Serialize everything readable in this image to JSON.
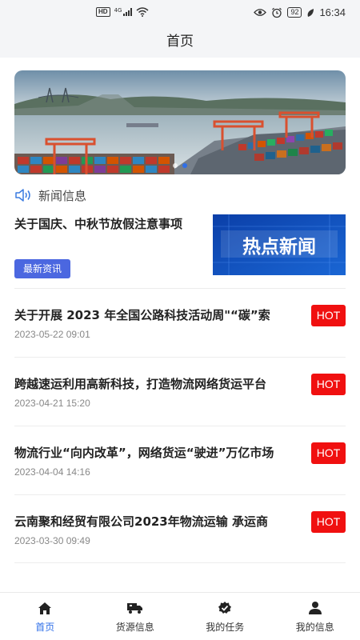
{
  "status_bar": {
    "network_badge": "HD",
    "network_type": "4G",
    "battery": "92",
    "time": "16:34"
  },
  "header": {
    "title": "首页"
  },
  "banner": {
    "slides": 2,
    "active_index": 1
  },
  "news_section": {
    "title": "新闻信息",
    "featured": {
      "title": "关于国庆、中秋节放假注意事项",
      "tag": "最新资讯",
      "thumbnail_text": "热点新闻"
    },
    "items": [
      {
        "title": "关于开展 2023 年全国公路科技活动周\"“碳”索",
        "date": "2023-05-22 09:01",
        "badge": "HOT"
      },
      {
        "title": "跨越速运利用高新科技，打造物流网络货运平台",
        "date": "2023-04-21 15:20",
        "badge": "HOT"
      },
      {
        "title": "物流行业“向内改革”，网络货运“驶进”万亿市场",
        "date": "2023-04-04 14:16",
        "badge": "HOT"
      },
      {
        "title": "云南聚和经贸有限公司2023年物流运输 承运商",
        "date": "2023-03-30 09:49",
        "badge": "HOT"
      }
    ]
  },
  "tabbar": {
    "tabs": [
      {
        "label": "首页",
        "icon": "home-icon",
        "active": true
      },
      {
        "label": "货源信息",
        "icon": "truck-icon",
        "active": false
      },
      {
        "label": "我的任务",
        "icon": "task-check-icon",
        "active": false
      },
      {
        "label": "我的信息",
        "icon": "user-icon",
        "active": false
      }
    ]
  },
  "colors": {
    "accent": "#2f6fe8",
    "tag": "#4b67e0",
    "hot": "#f01010"
  }
}
